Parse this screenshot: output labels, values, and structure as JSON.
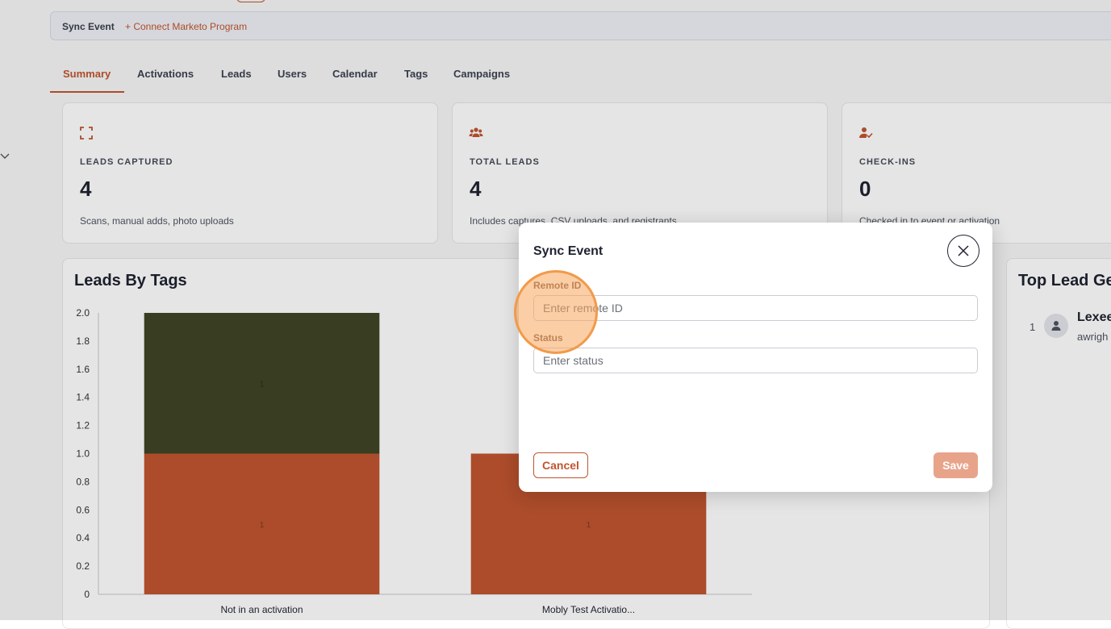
{
  "sync_bar": {
    "label": "Sync Event",
    "link": "+ Connect Marketo Program"
  },
  "tabs": [
    {
      "label": "Summary",
      "active": true
    },
    {
      "label": "Activations"
    },
    {
      "label": "Leads"
    },
    {
      "label": "Users"
    },
    {
      "label": "Calendar"
    },
    {
      "label": "Tags"
    },
    {
      "label": "Campaigns"
    }
  ],
  "stats": [
    {
      "icon": "scan-icon",
      "title": "LEADS CAPTURED",
      "value": "4",
      "description": "Scans, manual adds, photo uploads"
    },
    {
      "icon": "users-icon",
      "title": "TOTAL LEADS",
      "value": "4",
      "description": "Includes captures, CSV uploads, and registrants"
    },
    {
      "icon": "user-check-icon",
      "title": "CHECK-INS",
      "value": "0",
      "description": "Checked in to event or activation"
    }
  ],
  "leads_by_tags": {
    "title": "Leads By Tags"
  },
  "top_leads": {
    "title": "Top Lead Ge",
    "rank": "1",
    "name": "Lexee",
    "email": "awrigh"
  },
  "chart_data": {
    "type": "bar",
    "stacked": true,
    "categories": [
      "Not in an activation",
      "Mobly Test Activatio..."
    ],
    "series": [
      {
        "values": [
          1,
          1
        ],
        "color": "#c0552f",
        "data_labels": [
          "1",
          "1"
        ]
      },
      {
        "values": [
          1,
          0
        ],
        "color": "#404525",
        "data_labels": [
          "1",
          ""
        ]
      }
    ],
    "ylim": [
      0,
      2.0
    ],
    "yticks": [
      "0",
      "0.2",
      "0.4",
      "0.6",
      "0.8",
      "1.0",
      "1.2",
      "1.4",
      "1.6",
      "1.8",
      "2.0"
    ],
    "grid": false
  },
  "modal": {
    "title": "Sync Event",
    "remote_id": {
      "label": "Remote ID",
      "placeholder": "Enter remote ID",
      "value": ""
    },
    "status": {
      "label": "Status",
      "placeholder": "Enter status",
      "value": ""
    },
    "cancel_label": "Cancel",
    "save_label": "Save"
  },
  "colors": {
    "accent": "#c0552f",
    "save_disabled": "#e8a48a",
    "click_highlight": "#f29a49"
  }
}
